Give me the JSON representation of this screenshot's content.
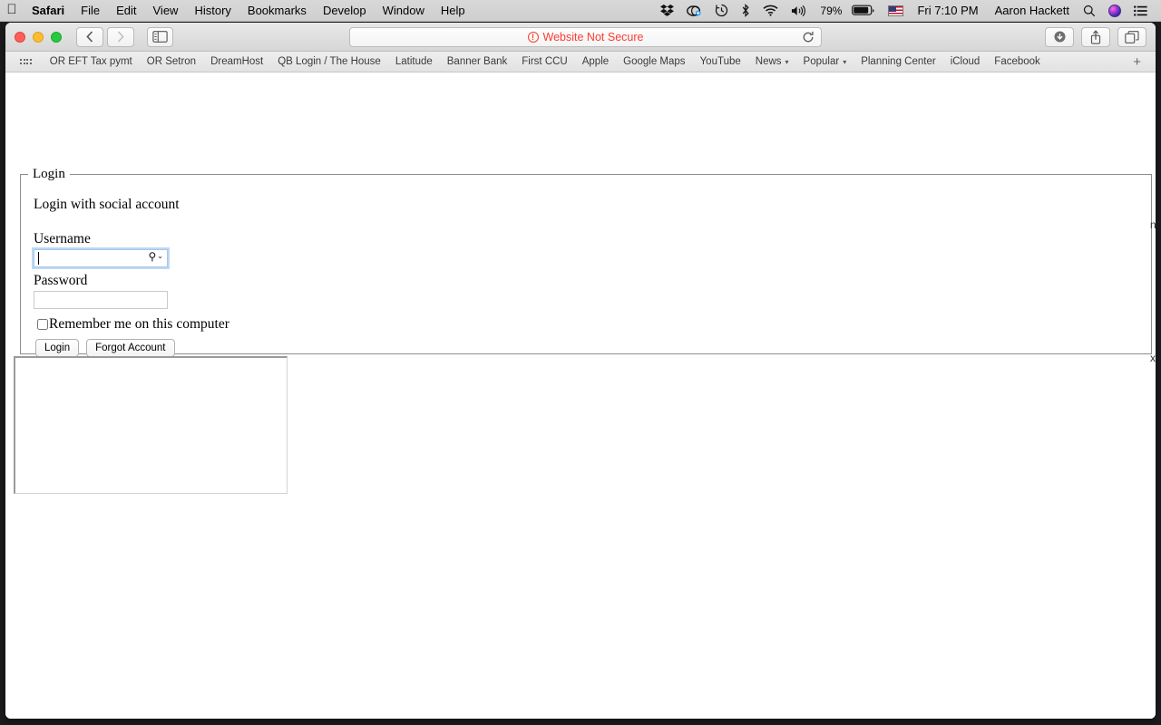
{
  "menubar": {
    "apple_icon": "apple-logo-icon",
    "items": [
      {
        "label": "Safari",
        "bold": true
      },
      {
        "label": "File",
        "bold": false
      },
      {
        "label": "Edit",
        "bold": false
      },
      {
        "label": "View",
        "bold": false
      },
      {
        "label": "History",
        "bold": false
      },
      {
        "label": "Bookmarks",
        "bold": false
      },
      {
        "label": "Develop",
        "bold": false
      },
      {
        "label": "Window",
        "bold": false
      },
      {
        "label": "Help",
        "bold": false
      }
    ],
    "tray": {
      "dropbox_icon": "dropbox-icon",
      "cloudapp_icon": "cloudapp-icon",
      "timemachine_icon": "time-machine-icon",
      "bluetooth_icon": "bluetooth-icon",
      "wifi_icon": "wifi-icon",
      "volume_icon": "volume-icon",
      "battery_percent": "79%",
      "battery_icon": "battery-icon",
      "flag_icon": "us-flag-icon",
      "clock": "Fri 7:10 PM",
      "user": "Aaron Hackett",
      "search_icon": "spotlight-search-icon",
      "siri_icon": "siri-icon",
      "notification_icon": "notification-center-icon"
    }
  },
  "toolbar": {
    "back_icon": "back-chevron-icon",
    "forward_icon": "forward-chevron-icon",
    "sidebar_icon": "sidebar-toggle-icon",
    "url_warning": "Website Not Secure",
    "warning_icon": "exclamation-circle-icon",
    "reload_icon": "reload-icon",
    "downloads_icon": "downloads-icon",
    "share_icon": "share-icon",
    "tabs_icon": "tab-overview-icon"
  },
  "bookmarks": {
    "apps_icon": "bookmarks-grid-icon",
    "items": [
      {
        "label": "OR EFT Tax pymt",
        "dropdown": false
      },
      {
        "label": "OR Setron",
        "dropdown": false
      },
      {
        "label": "DreamHost",
        "dropdown": false
      },
      {
        "label": "QB Login / The House",
        "dropdown": false
      },
      {
        "label": "Latitude",
        "dropdown": false
      },
      {
        "label": "Banner Bank",
        "dropdown": false
      },
      {
        "label": "First CCU",
        "dropdown": false
      },
      {
        "label": "Apple",
        "dropdown": false
      },
      {
        "label": "Google Maps",
        "dropdown": false
      },
      {
        "label": "YouTube",
        "dropdown": false
      },
      {
        "label": "News",
        "dropdown": true
      },
      {
        "label": "Popular",
        "dropdown": true
      },
      {
        "label": "Planning Center",
        "dropdown": false
      },
      {
        "label": "iCloud",
        "dropdown": false
      },
      {
        "label": "Facebook",
        "dropdown": false
      }
    ],
    "new_tab_label": "+"
  },
  "page": {
    "legend": "Login",
    "social_heading": "Login with social account",
    "username_label": "Username",
    "username_value": "",
    "username_placeholder": "",
    "autofill_key_glyph": "⚲",
    "autofill_chevron": "⌄",
    "password_label": "Password",
    "password_value": "",
    "password_placeholder": "",
    "remember_label": "Remember me on this computer",
    "remember_checked": false,
    "login_button": "Login",
    "forgot_button": "Forgot Account",
    "edge_fragment_1": "n",
    "edge_fragment_2": "x"
  }
}
